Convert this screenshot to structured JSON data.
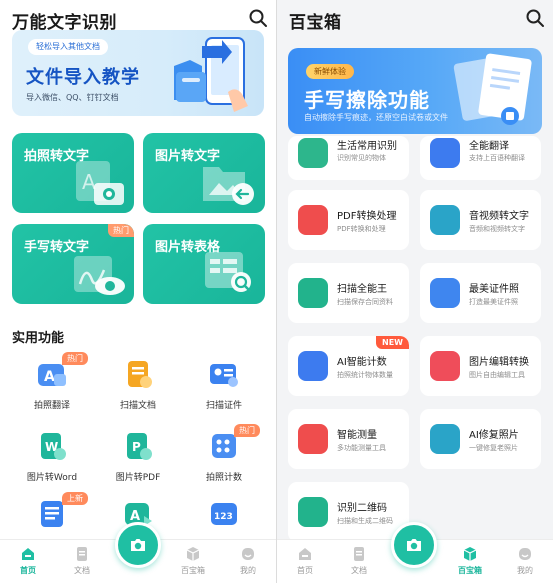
{
  "left": {
    "title": "万能文字识别",
    "banner": {
      "pill": "轻松导入其他文档",
      "title": "文件导入教学",
      "subtitle": "导入微信、QQ、钉钉文档"
    },
    "cards": [
      {
        "label": "拍照转文字",
        "icon": "camera-doc-icon"
      },
      {
        "label": "图片转文字",
        "icon": "image-folder-icon"
      },
      {
        "label": "手写转文字",
        "icon": "handwriting-eye-icon",
        "tag": "热门"
      },
      {
        "label": "图片转表格",
        "icon": "table-search-icon"
      }
    ],
    "section_title": "实用功能",
    "tools": [
      {
        "label": "拍照翻译",
        "icon": "translate-icon",
        "tag": "热门"
      },
      {
        "label": "扫描文档",
        "icon": "scan-doc-icon"
      },
      {
        "label": "扫描证件",
        "icon": "id-card-icon"
      },
      {
        "label": "图片转Word",
        "icon": "word-icon"
      },
      {
        "label": "图片转PDF",
        "icon": "pdf-icon"
      },
      {
        "label": "拍照计数",
        "icon": "count-icon",
        "tag": "热门"
      },
      {
        "label": "",
        "icon": "list-icon",
        "tag": "上新"
      },
      {
        "label": "",
        "icon": "video-text-icon"
      },
      {
        "label": "",
        "icon": "number-recognize-icon"
      }
    ],
    "nav": [
      {
        "label": "首页",
        "icon": "home-icon",
        "active": true
      },
      {
        "label": "文档",
        "icon": "doc-icon",
        "active": false
      },
      {
        "label": "百宝箱",
        "icon": "box-icon",
        "active": false
      },
      {
        "label": "我的",
        "icon": "profile-icon",
        "active": false
      }
    ]
  },
  "right": {
    "title": "百宝箱",
    "banner": {
      "pill": "新鲜体验",
      "title": "手写擦除功能",
      "subtitle": "自动擦除手写痕迹，还原空白试卷或文件"
    },
    "tools": [
      {
        "name": "生活常用识别",
        "desc": "识别常见的物体",
        "icon": "life-icon",
        "color": "#2db68c"
      },
      {
        "name": "全能翻译",
        "desc": "支持上百语种翻译",
        "icon": "translate-all-icon",
        "color": "#3d7bef"
      },
      {
        "name": "PDF转换处理",
        "desc": "PDF转换和处理",
        "icon": "pdf-convert-icon",
        "color": "#ef4d4d"
      },
      {
        "name": "音视频转文字",
        "desc": "音频和视频转文字",
        "icon": "media-text-icon",
        "color": "#2aa4c8"
      },
      {
        "name": "扫描全能王",
        "desc": "扫描保存合同资料",
        "icon": "scanner-icon",
        "color": "#22b38c"
      },
      {
        "name": "最美证件照",
        "desc": "打造最美证件照",
        "icon": "id-photo-icon",
        "color": "#3f86ef"
      },
      {
        "name": "AI智能计数",
        "desc": "拍照统计物体数量",
        "icon": "ai-count-icon",
        "color": "#3d7bef",
        "tag": "NEW"
      },
      {
        "name": "图片编辑转换",
        "desc": "图片自由编辑工具",
        "icon": "image-edit-icon",
        "color": "#ef4d5a"
      },
      {
        "name": "智能测量",
        "desc": "多功能测量工具",
        "icon": "ruler-icon",
        "color": "#ef4d4d"
      },
      {
        "name": "AI修复照片",
        "desc": "一键修复老照片",
        "icon": "photo-repair-icon",
        "color": "#2aa4c8"
      },
      {
        "name": "识别二维码",
        "desc": "扫描和生成二维码",
        "icon": "qrcode-icon",
        "color": "#22b38c"
      }
    ],
    "nav": [
      {
        "label": "首页",
        "icon": "home-icon",
        "active": false
      },
      {
        "label": "文档",
        "icon": "doc-icon",
        "active": false
      },
      {
        "label": "百宝箱",
        "icon": "box-icon",
        "active": true
      },
      {
        "label": "我的",
        "icon": "profile-icon",
        "active": false
      }
    ]
  },
  "colors": {
    "accent": "#1fbfa3",
    "card": "#1fbb9f",
    "tag_hot": "#ff8a5c",
    "tag_new": "#ff5a3c"
  }
}
